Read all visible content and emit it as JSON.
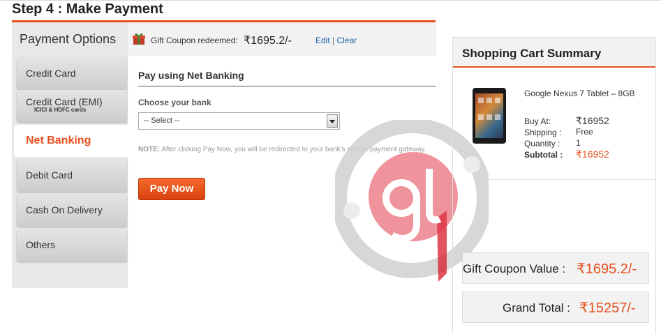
{
  "header": {
    "title": "Step 4 : Make Payment"
  },
  "payment_options": {
    "title": "Payment Options",
    "tabs": [
      {
        "label": "Credit Card"
      },
      {
        "label": "Credit Card (EMI)",
        "sublabel": "ICICI & HDFC cards"
      },
      {
        "label": "Net Banking",
        "active": true
      },
      {
        "label": "Debit Card"
      },
      {
        "label": "Cash On Delivery"
      },
      {
        "label": "Others"
      }
    ]
  },
  "coupon": {
    "icon": "gift-icon",
    "label": "Gift Coupon redeemed:",
    "amount": "₹1695.2/-",
    "edit_label": "Edit",
    "separator": "|",
    "clear_label": "Clear"
  },
  "net_banking": {
    "heading": "Pay using Net Banking",
    "choose_label": "Choose your bank",
    "select_value": "-- Select --",
    "note_prefix": "NOTE:",
    "note_text": " After clicking Pay Now, you will be redirected to your bank's secure payment gateway.",
    "pay_button": "Pay Now"
  },
  "cart": {
    "title": "Shopping Cart Summary",
    "product_name": "Google Nexus 7 Tablet – 8GB",
    "buy_at_label": "Buy At:",
    "buy_at_value": "₹16952",
    "shipping_label": "Shipping :",
    "shipping_value": "Free",
    "quantity_label": "Quantity :",
    "quantity_value": "1",
    "subtotal_label": "Subtotal :",
    "subtotal_value": "₹16952",
    "gift_coupon_label": "Gift Coupon Value :",
    "gift_coupon_value": "₹1695.2/-",
    "grand_total_label": "Grand Total :",
    "grand_total_value": "₹15257/-"
  },
  "colors": {
    "accent": "#e8501e",
    "link": "#1a5fa8",
    "panel": "#e8e8e8"
  }
}
